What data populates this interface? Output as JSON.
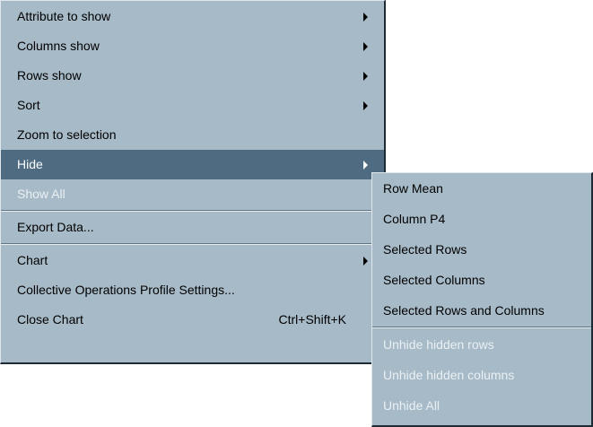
{
  "main_menu": {
    "items": [
      {
        "label": "Attribute to show"
      },
      {
        "label": "Columns show"
      },
      {
        "label": "Rows show"
      },
      {
        "label": "Sort"
      },
      {
        "label": "Zoom to selection"
      },
      {
        "label": "Hide"
      },
      {
        "label": "Show All"
      },
      {
        "label": "Export Data..."
      },
      {
        "label": "Chart"
      },
      {
        "label": "Collective Operations Profile Settings..."
      },
      {
        "label": "Close Chart",
        "shortcut": "Ctrl+Shift+K"
      }
    ]
  },
  "sub_menu": {
    "items": [
      {
        "label": "Row Mean"
      },
      {
        "label": "Column P4"
      },
      {
        "label": "Selected Rows"
      },
      {
        "label": "Selected Columns"
      },
      {
        "label": "Selected Rows and Columns"
      },
      {
        "label": "Unhide hidden rows"
      },
      {
        "label": "Unhide hidden columns"
      },
      {
        "label": "Unhide All"
      }
    ]
  },
  "colors": {
    "menu_background": "#a7bac7",
    "highlight": "#4e6b81",
    "disabled_text": "#eaf0f3"
  }
}
